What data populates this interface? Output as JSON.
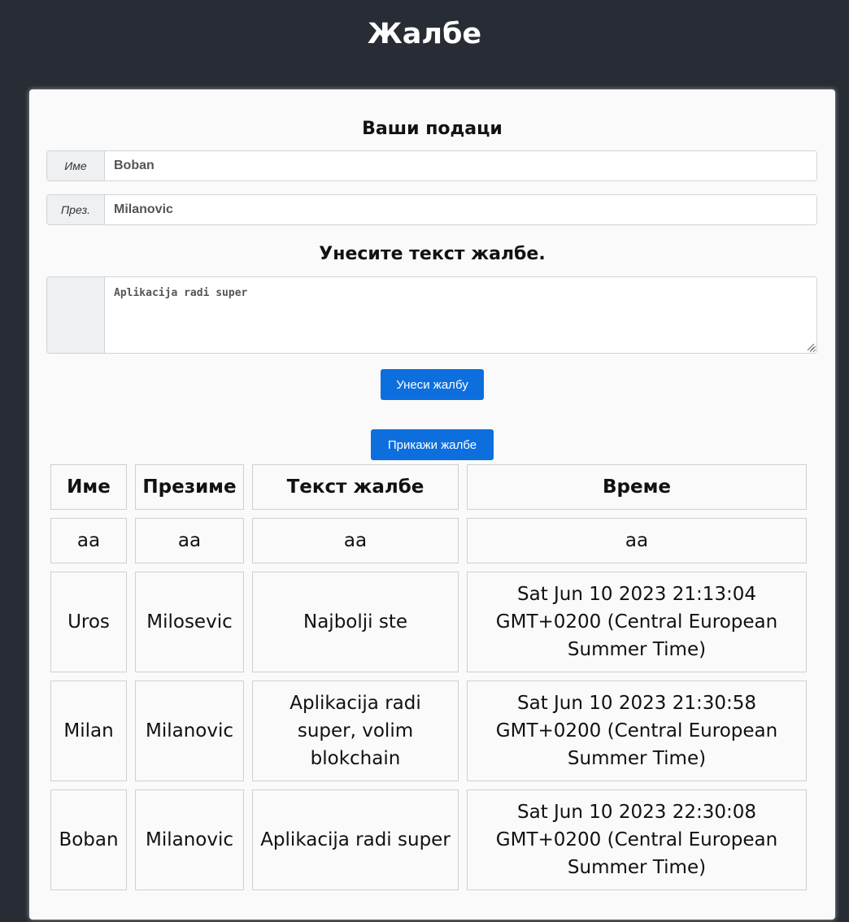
{
  "header": {
    "title": "Жалбе"
  },
  "form": {
    "section_title": "Ваши подаци",
    "first_name": {
      "addon": "Име",
      "value": "Boban"
    },
    "last_name": {
      "addon": "През.",
      "value": "Milanovic"
    },
    "complaint_title": "Унесите текст жалбе.",
    "complaint_text": "Aplikacija radi super",
    "submit_label": "Унеси жалбу",
    "show_label": "Прикажи жалбе"
  },
  "table": {
    "headers": [
      "Име",
      "Презиме",
      "Текст жалбе",
      "Време"
    ],
    "rows": [
      [
        "aa",
        "aa",
        "aa",
        "aa"
      ],
      [
        "Uros",
        "Milosevic",
        "Najbolji ste",
        "Sat Jun 10 2023 21:13:04 GMT+0200 (Central European Summer Time)"
      ],
      [
        "Milan",
        "Milanovic",
        "Aplikacija radi super, volim blokchain",
        "Sat Jun 10 2023 21:30:58 GMT+0200 (Central European Summer Time)"
      ],
      [
        "Boban",
        "Milanovic",
        "Aplikacija radi super",
        "Sat Jun 10 2023 22:30:08 GMT+0200 (Central European Summer Time)"
      ]
    ]
  },
  "colors": {
    "background": "#282c34",
    "card": "#fafafa",
    "accent": "#0d6fde"
  }
}
